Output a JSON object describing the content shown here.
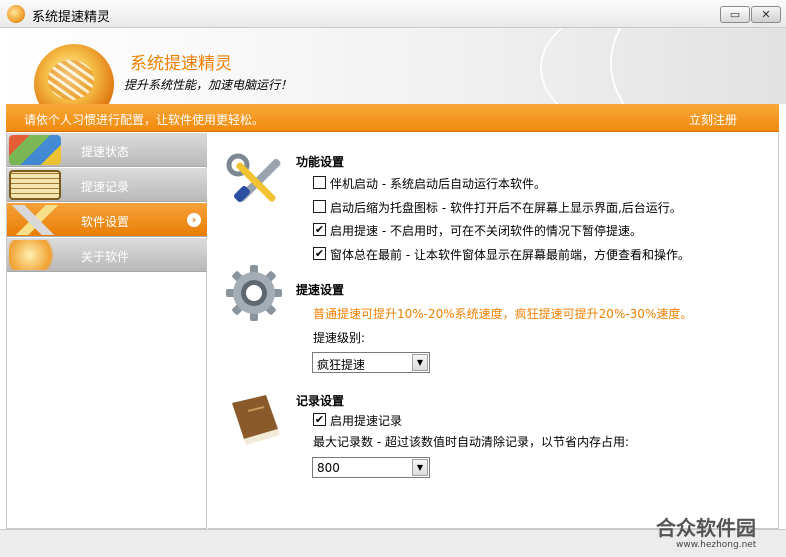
{
  "window": {
    "title": "系统提速精灵",
    "minimize_glyph": "▭",
    "close_glyph": "✕"
  },
  "header": {
    "title": "系统提速精灵",
    "subtitle": "提升系统性能，加速电脑运行！"
  },
  "banner": {
    "hint": "请依个人习惯进行配置，让软件使用更轻松。",
    "register": "立刻注册"
  },
  "sidebar": {
    "items": [
      {
        "label": "提速状态",
        "icon": "windows-logo-icon",
        "active": false
      },
      {
        "label": "提速记录",
        "icon": "records-icon",
        "active": false
      },
      {
        "label": "软件设置",
        "icon": "tools-icon",
        "active": true
      },
      {
        "label": "关于软件",
        "icon": "app-logo-icon",
        "active": false
      }
    ],
    "arrow_glyph": "›"
  },
  "settings": {
    "function": {
      "title": "功能设置",
      "options": [
        {
          "label": "伴机启动 - 系统启动后自动运行本软件。",
          "checked": false
        },
        {
          "label": "启动后缩为托盘图标 - 软件打开后不在屏幕上显示界面,后台运行。",
          "checked": false
        },
        {
          "label": "启用提速 - 不启用时，可在不关闭软件的情况下暂停提速。",
          "checked": true
        },
        {
          "label": "窗体总在最前 - 让本软件窗体显示在屏幕最前端，方便查看和操作。",
          "checked": true
        }
      ]
    },
    "speed": {
      "title": "提速设置",
      "description": "普通提速可提升10%-20%系统速度，疯狂提速可提升20%-30%速度。",
      "level_label": "提速级别:",
      "level_value": "疯狂提速"
    },
    "record": {
      "title": "记录设置",
      "enable_label": "启用提速记录",
      "enable_checked": true,
      "max_label": "最大记录数 - 超过该数值时自动清除记录，以节省内存占用:",
      "max_value": "800"
    },
    "check_glyph": "✔",
    "dropdown_glyph": "▼"
  },
  "watermark": {
    "text": "合众软件园",
    "url": "www.hezhong.net"
  },
  "colors": {
    "accent": "#f18a0d",
    "accent_text": "#f08000"
  }
}
